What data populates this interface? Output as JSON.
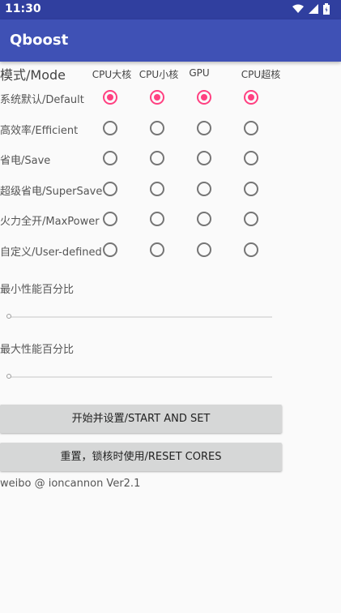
{
  "status_bar": {
    "time": "11:30",
    "icons": [
      "wifi-icon",
      "signal-icon",
      "battery-icon"
    ]
  },
  "app": {
    "title": "Qboost"
  },
  "mode_header": "模式/Mode",
  "columns": [
    "CPU大核",
    "CPU小核",
    "GPU",
    "CPU超核"
  ],
  "modes": [
    {
      "label": "系统默认/Default",
      "selected": [
        true,
        true,
        true,
        true
      ]
    },
    {
      "label": "高效率/Efficient",
      "selected": [
        false,
        false,
        false,
        false
      ]
    },
    {
      "label": "省电/Save",
      "selected": [
        false,
        false,
        false,
        false
      ]
    },
    {
      "label": "超级省电/SuperSave",
      "selected": [
        false,
        false,
        false,
        false
      ]
    },
    {
      "label": "火力全开/MaxPower",
      "selected": [
        false,
        false,
        false,
        false
      ]
    },
    {
      "label": "自定义/User-defined",
      "selected": [
        false,
        false,
        false,
        false
      ]
    }
  ],
  "sliders": {
    "min_label": "最小性能百分比",
    "min_value": 0,
    "max_label": "最大性能百分比",
    "max_value": 0
  },
  "buttons": {
    "start_set": "开始并设置/START AND SET",
    "reset": "重置，锁核时使用/RESET CORES"
  },
  "footer": "weibo @ ioncannon Ver2.1",
  "colors": {
    "primary": "#3f51b5",
    "primary_dark": "#303f9f",
    "accent": "#ff4081"
  }
}
